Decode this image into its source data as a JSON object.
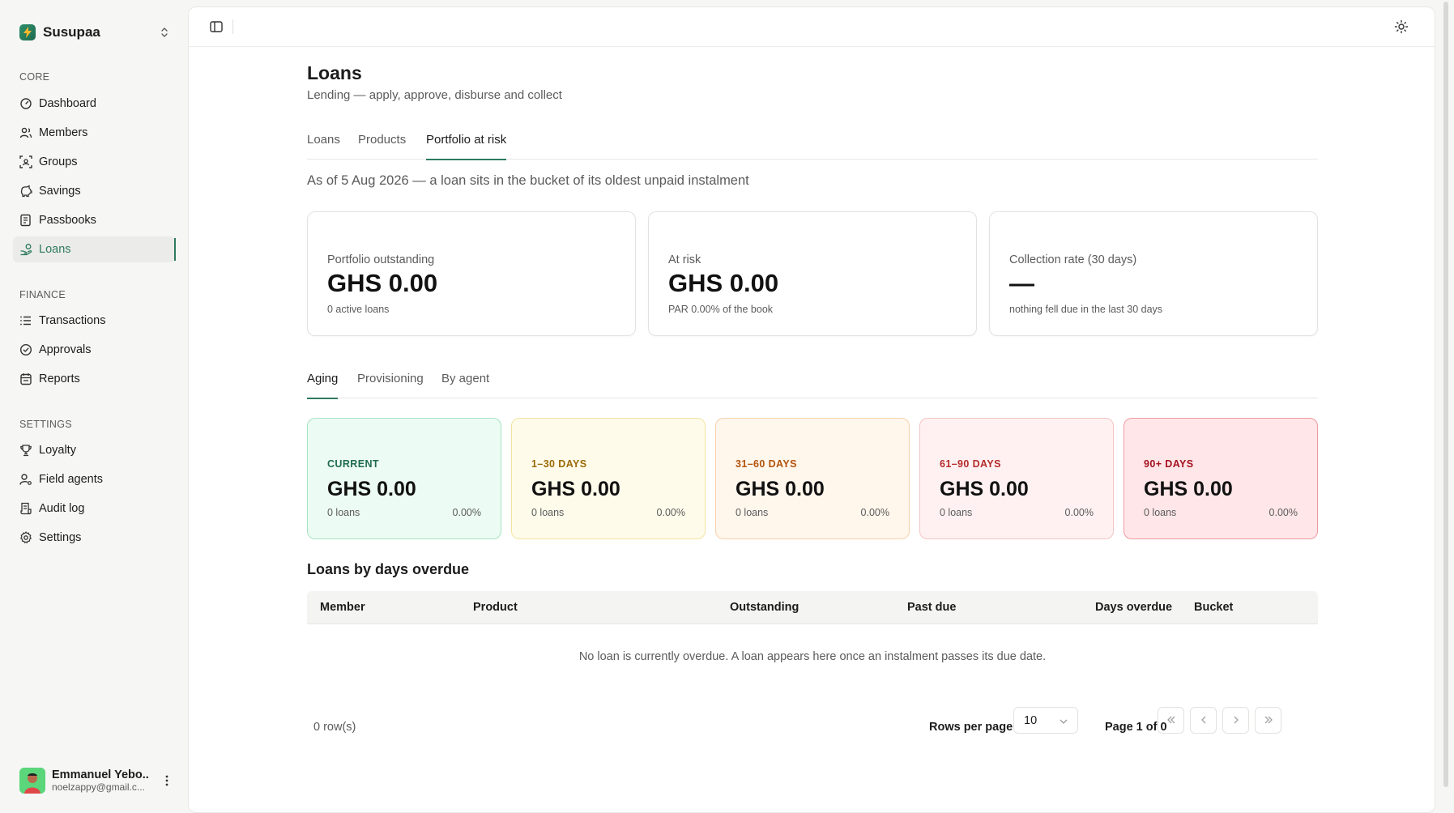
{
  "brand": {
    "name": "Susupaa"
  },
  "sidebar": {
    "sections": [
      {
        "label": "CORE",
        "items": [
          {
            "label": "Dashboard",
            "icon": "dashboard-icon"
          },
          {
            "label": "Members",
            "icon": "users-icon"
          },
          {
            "label": "Groups",
            "icon": "groups-icon"
          },
          {
            "label": "Savings",
            "icon": "piggy-bank-icon"
          },
          {
            "label": "Passbooks",
            "icon": "book-icon"
          },
          {
            "label": "Loans",
            "icon": "hand-coins-icon",
            "active": true
          }
        ]
      },
      {
        "label": "FINANCE",
        "items": [
          {
            "label": "Transactions",
            "icon": "list-icon"
          },
          {
            "label": "Approvals",
            "icon": "check-circle-icon"
          },
          {
            "label": "Reports",
            "icon": "report-icon"
          }
        ]
      },
      {
        "label": "SETTINGS",
        "items": [
          {
            "label": "Loyalty",
            "icon": "trophy-icon"
          },
          {
            "label": "Field agents",
            "icon": "user-cog-icon"
          },
          {
            "label": "Audit log",
            "icon": "audit-icon"
          },
          {
            "label": "Settings",
            "icon": "gear-icon"
          }
        ]
      }
    ]
  },
  "user": {
    "name": "Emmanuel Yebo...",
    "email": "noelzappy@gmail.c..."
  },
  "page": {
    "title": "Loans",
    "subtitle": "Lending — apply, approve, disburse and collect"
  },
  "tabs": [
    {
      "label": "Loans"
    },
    {
      "label": "Products"
    },
    {
      "label": "Portfolio at risk",
      "active": true
    }
  ],
  "asof": "As of 5 Aug 2026 — a loan sits in the bucket of its oldest unpaid instalment",
  "stats": [
    {
      "label": "Portfolio outstanding",
      "value": "GHS 0.00",
      "note": "0 active loans"
    },
    {
      "label": "At risk",
      "value": "GHS 0.00",
      "note": "PAR 0.00% of the book"
    },
    {
      "label": "Collection rate (30 days)",
      "value": "—",
      "note": "nothing fell due in the last 30 days"
    }
  ],
  "subtabs": [
    {
      "label": "Aging",
      "active": true
    },
    {
      "label": "Provisioning"
    },
    {
      "label": "By agent"
    }
  ],
  "buckets": [
    {
      "label": "CURRENT",
      "value": "GHS 0.00",
      "count": "0 loans",
      "pct": "0.00%",
      "bg": "#ecfbf3",
      "border": "#a7e3c3",
      "color": "#1f6b50"
    },
    {
      "label": "1–30 DAYS",
      "value": "GHS 0.00",
      "count": "0 loans",
      "pct": "0.00%",
      "bg": "#fffbea",
      "border": "#f3e3a0",
      "color": "#9a6a06"
    },
    {
      "label": "31–60 DAYS",
      "value": "GHS 0.00",
      "count": "0 loans",
      "pct": "0.00%",
      "bg": "#fff6ec",
      "border": "#f5d2ac",
      "color": "#b2530c"
    },
    {
      "label": "61–90 DAYS",
      "value": "GHS 0.00",
      "count": "0 loans",
      "pct": "0.00%",
      "bg": "#fff1f1",
      "border": "#f3c4c4",
      "color": "#b42b2b"
    },
    {
      "label": "90+ DAYS",
      "value": "GHS 0.00",
      "count": "0 loans",
      "pct": "0.00%",
      "bg": "#ffe6e8",
      "border": "#ef9aa2",
      "color": "#a3121f"
    }
  ],
  "section_title": "Loans by days overdue",
  "table": {
    "columns": [
      "Member",
      "Product",
      "Outstanding",
      "Past due",
      "Days overdue",
      "Bucket"
    ],
    "empty": "No loan is currently overdue. A loan appears here once an instalment passes its due date."
  },
  "pagination": {
    "rows": "0 row(s)",
    "rows_per_page_label": "Rows per page",
    "rows_per_page": "10",
    "page_info": "Page 1 of 0"
  }
}
